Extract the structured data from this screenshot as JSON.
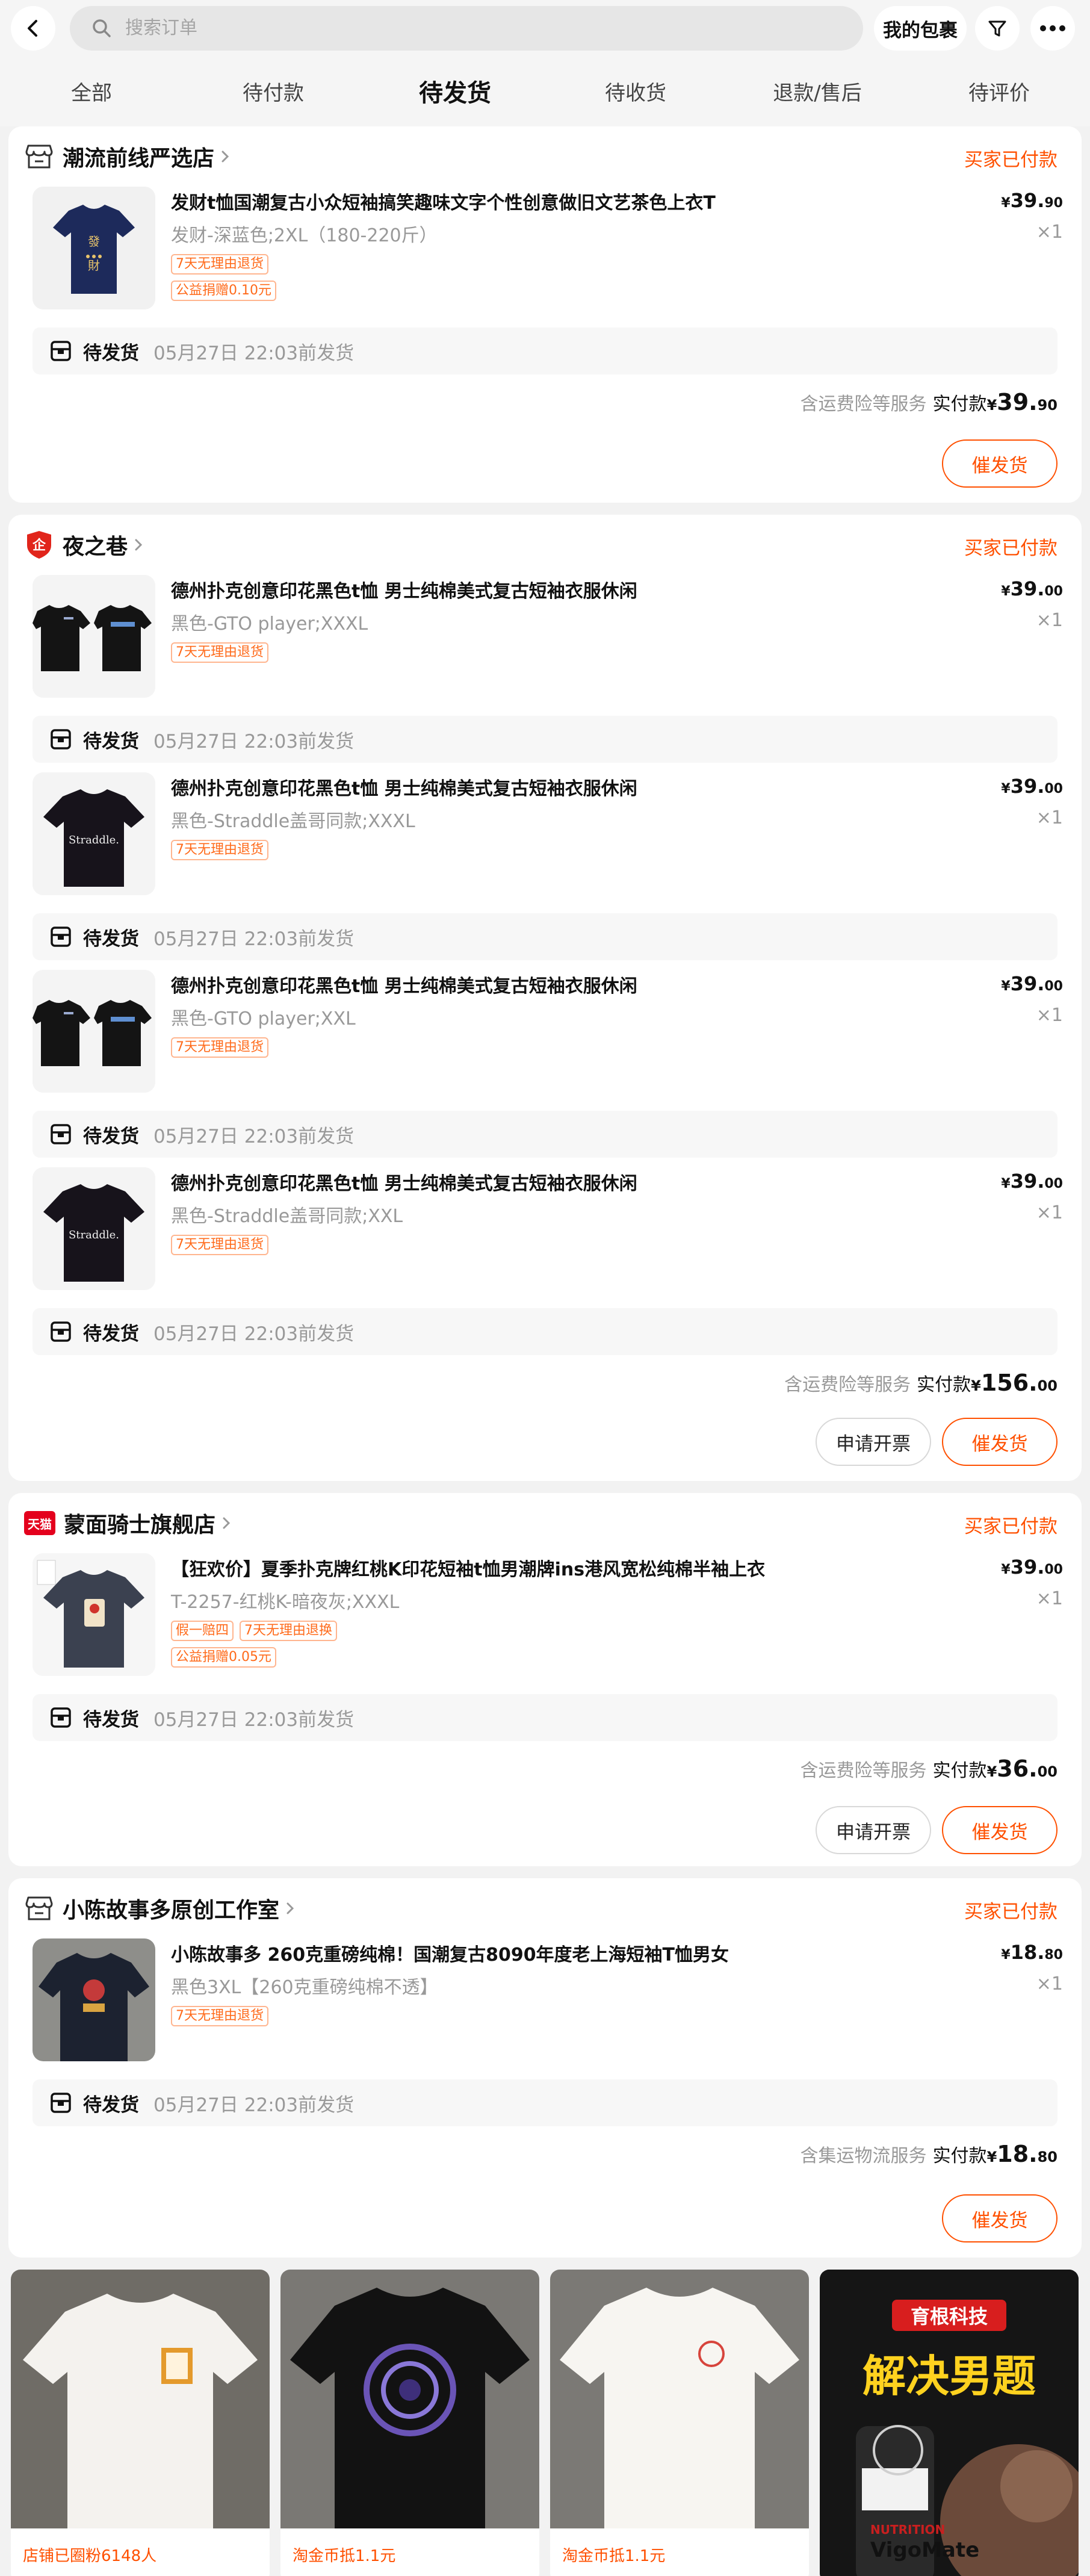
{
  "header": {
    "search_placeholder": "搜索订单",
    "my_wallet_label": "我的包裹"
  },
  "tabs": [
    "全部",
    "待付款",
    "待发货",
    "待收货",
    "退款/售后",
    "待评价"
  ],
  "active_tab": "待发货",
  "orders": [
    {
      "shop_name": "潮流前线严选店",
      "status": "买家已付款",
      "items": [
        {
          "title": "发财t恤国潮复古小众短袖搞笑趣味文字个性创意做旧文艺茶色上衣T",
          "spec": "发财-深蓝色;2XL（180-220斤）",
          "tags": [
            [
              "7天无理由退货"
            ],
            [
              "公益捐赠0.10元"
            ]
          ],
          "price_int": "39.",
          "price_dec": "90",
          "currency": "¥",
          "qty": "×1",
          "ship_label": "待发货",
          "ship_deadline": "05月27日 22:03前发货"
        }
      ],
      "service": "含运费险等服务",
      "paid_label": "实付款",
      "total_int": "39.",
      "total_dec": "90",
      "buttons": [
        "催发货"
      ]
    },
    {
      "shop_name": "夜之巷",
      "status": "买家已付款",
      "items": [
        {
          "title": "德州扑克创意印花黑色t恤 男士纯棉美式复古短袖衣服休闲",
          "spec": "黑色-GTO player;XXXL",
          "tags": [
            [
              "7天无理由退货"
            ]
          ],
          "price_int": "39.",
          "price_dec": "00",
          "currency": "¥",
          "qty": "×1",
          "ship_label": "待发货",
          "ship_deadline": "05月27日 22:03前发货"
        },
        {
          "title": "德州扑克创意印花黑色t恤 男士纯棉美式复古短袖衣服休闲",
          "spec": "黑色-Straddle盖哥同款;XXXL",
          "tags": [
            [
              "7天无理由退货"
            ]
          ],
          "price_int": "39.",
          "price_dec": "00",
          "currency": "¥",
          "qty": "×1",
          "ship_label": "待发货",
          "ship_deadline": "05月27日 22:03前发货"
        },
        {
          "title": "德州扑克创意印花黑色t恤 男士纯棉美式复古短袖衣服休闲",
          "spec": "黑色-GTO player;XXL",
          "tags": [
            [
              "7天无理由退货"
            ]
          ],
          "price_int": "39.",
          "price_dec": "00",
          "currency": "¥",
          "qty": "×1",
          "ship_label": "待发货",
          "ship_deadline": "05月27日 22:03前发货"
        },
        {
          "title": "德州扑克创意印花黑色t恤 男士纯棉美式复古短袖衣服休闲",
          "spec": "黑色-Straddle盖哥同款;XXL",
          "tags": [
            [
              "7天无理由退货"
            ]
          ],
          "price_int": "39.",
          "price_dec": "00",
          "currency": "¥",
          "qty": "×1",
          "ship_label": "待发货",
          "ship_deadline": "05月27日 22:03前发货"
        }
      ],
      "service": "含运费险等服务",
      "paid_label": "实付款",
      "total_int": "156.",
      "total_dec": "00",
      "buttons": [
        "申请开票",
        "催发货"
      ]
    },
    {
      "shop_name": "蒙面骑士旗舰店",
      "shop_badge": "天猫",
      "status": "买家已付款",
      "items": [
        {
          "title": "【狂欢价】夏季扑克牌红桃K印花短袖t恤男潮牌ins港风宽松纯棉半袖上衣",
          "spec": "T-2257-红桃K-暗夜灰;XXXL",
          "tags": [
            [
              "假一赔四",
              "7天无理由退换"
            ],
            [
              "公益捐赠0.05元"
            ]
          ],
          "price_int": "39.",
          "price_dec": "00",
          "currency": "¥",
          "qty": "×1",
          "ship_label": "待发货",
          "ship_deadline": "05月27日 22:03前发货"
        }
      ],
      "service": "含运费险等服务",
      "paid_label": "实付款",
      "total_int": "36.",
      "total_dec": "00",
      "buttons": [
        "申请开票",
        "催发货"
      ]
    },
    {
      "shop_name": "小陈故事多原创工作室",
      "status": "买家已付款",
      "items": [
        {
          "title": "小陈故事多 260克重磅纯棉！国潮复古8090年度老上海短袖T恤男女",
          "spec": "黑色3XL【260克重磅纯棉不透】",
          "tags": [
            [
              "7天无理由退货"
            ]
          ],
          "price_int": "18.",
          "price_dec": "80",
          "currency": "¥",
          "qty": "×1",
          "ship_label": "待发货",
          "ship_deadline": "05月27日 22:03前发货"
        }
      ],
      "service": "含集运物流服务",
      "paid_label": "实付款",
      "total_int": "18.",
      "total_dec": "80",
      "buttons": [
        "催发货"
      ]
    }
  ],
  "recommendations": [
    {
      "tag": "店铺已圈粉6148人"
    },
    {
      "tag": "淘金币抵1.1元"
    },
    {
      "tag": "淘金币抵1.1元"
    },
    {
      "ad_brand": "育根科技",
      "ad_headline": "解决男题",
      "ad_product": "VigoMate",
      "ad_badge": "NUTRITION"
    }
  ],
  "colors": {
    "accent": "#ff5000",
    "tag_border": "#ffb58f",
    "muted": "#999999",
    "page_bg": "#f2f2f2"
  }
}
